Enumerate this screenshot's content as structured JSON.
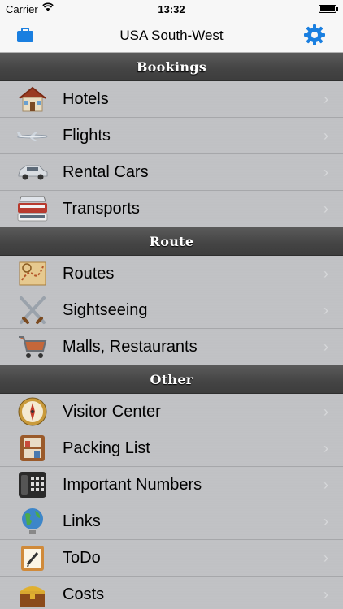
{
  "status": {
    "carrier": "Carrier",
    "time": "13:32"
  },
  "navbar": {
    "title": "USA South-West",
    "left_icon": "briefcase-icon",
    "right_icon": "gear-icon"
  },
  "colors": {
    "accent": "#1a7fe0",
    "section": "#4a4a4a",
    "row": "#bfc1c4"
  },
  "sections": [
    {
      "title": "Bookings",
      "items": [
        {
          "label": "Hotels",
          "icon": "house-icon"
        },
        {
          "label": "Flights",
          "icon": "airplane-icon"
        },
        {
          "label": "Rental Cars",
          "icon": "car-icon"
        },
        {
          "label": "Transports",
          "icon": "bus-icon"
        }
      ]
    },
    {
      "title": "Route",
      "items": [
        {
          "label": "Routes",
          "icon": "map-icon"
        },
        {
          "label": "Sightseeing",
          "icon": "crossed-swords-icon"
        },
        {
          "label": "Malls, Restaurants",
          "icon": "shopping-cart-icon"
        }
      ]
    },
    {
      "title": "Other",
      "items": [
        {
          "label": "Visitor Center",
          "icon": "compass-icon"
        },
        {
          "label": "Packing List",
          "icon": "shelf-icon"
        },
        {
          "label": "Important Numbers",
          "icon": "phone-icon"
        },
        {
          "label": "Links",
          "icon": "globe-icon"
        },
        {
          "label": "ToDo",
          "icon": "notepad-icon"
        },
        {
          "label": "Costs",
          "icon": "treasure-chest-icon"
        }
      ]
    }
  ]
}
